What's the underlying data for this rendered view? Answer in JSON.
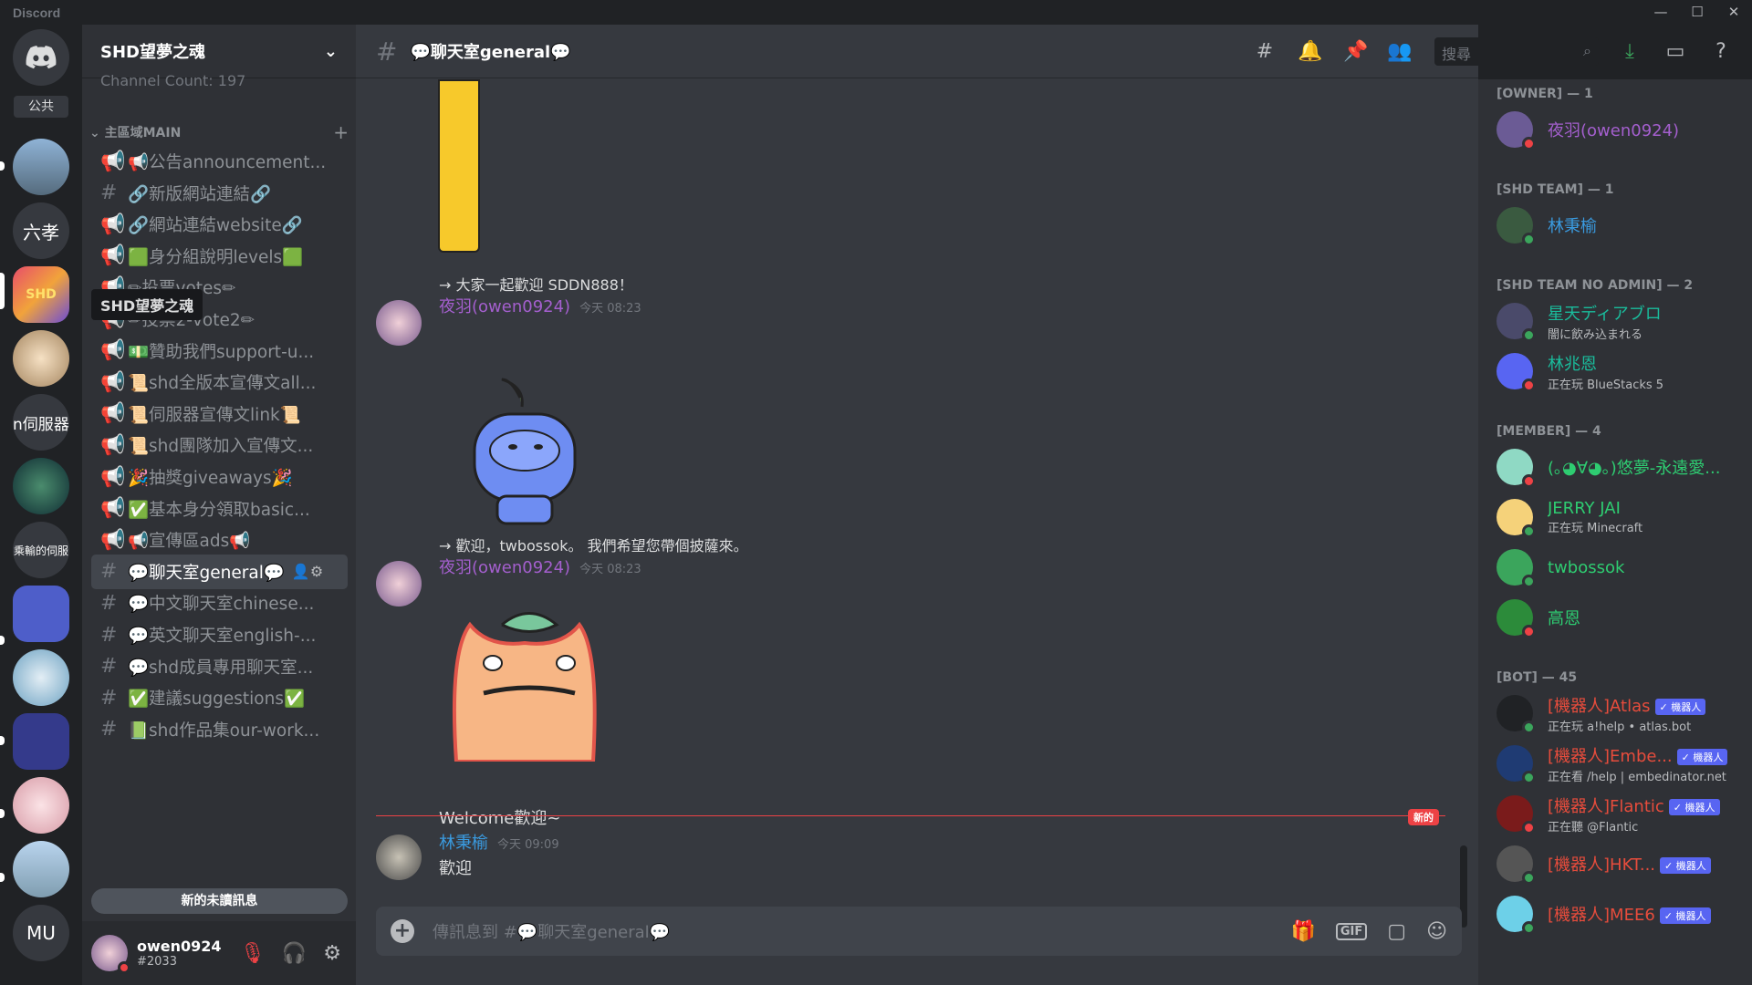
{
  "window": {
    "title": "Discord",
    "controls": [
      "—",
      "☐",
      "✕"
    ]
  },
  "servers": {
    "home_badge": "公共",
    "items": [
      "六孝",
      "n伺服器",
      "乘輸的伺服",
      "MU"
    ],
    "tooltip": "SHD望夢之魂"
  },
  "server": {
    "name": "SHD望夢之魂",
    "top_text": "Channel Count: 197",
    "category": "主區域MAIN",
    "unread_bar": "新的未讀訊息"
  },
  "channels": [
    {
      "sym": "📢",
      "name": "📢公告announcement..."
    },
    {
      "sym": "#",
      "name": "🔗新版網站連結🔗"
    },
    {
      "sym": "📢",
      "name": "🔗網站連結website🔗"
    },
    {
      "sym": "📢",
      "name": "🟩身分組說明levels🟩"
    },
    {
      "sym": "📢",
      "name": "✏投票votes✏"
    },
    {
      "sym": "📢",
      "name": "✏投票2-vote2✏"
    },
    {
      "sym": "📢",
      "name": "💵贊助我們support-u..."
    },
    {
      "sym": "📢",
      "name": "📜shd全版本宣傳文all..."
    },
    {
      "sym": "📢",
      "name": "📜伺服器宣傳文link📜"
    },
    {
      "sym": "📢",
      "name": "📜shd團隊加入宣傳文..."
    },
    {
      "sym": "📢",
      "name": "🎉抽獎giveaways🎉"
    },
    {
      "sym": "📢",
      "name": "✅基本身分領取basic..."
    },
    {
      "sym": "📢",
      "name": "📢宣傳區ads📢"
    },
    {
      "sym": "#",
      "name": "💬聊天室general💬"
    },
    {
      "sym": "#",
      "name": "💬中文聊天室chinese..."
    },
    {
      "sym": "#",
      "name": "💬英文聊天室english-..."
    },
    {
      "sym": "#",
      "name": "💬shd成員專用聊天室..."
    },
    {
      "sym": "#",
      "name": "✅建議suggestions✅"
    },
    {
      "sym": "#",
      "name": "📗shd作品集our-work..."
    }
  ],
  "user": {
    "name": "owen0924",
    "tag": "#2033"
  },
  "chat": {
    "channel_title": "💬聊天室general💬",
    "search_placeholder": "搜尋",
    "messages": [
      {
        "reply": "→ 大家一起歡迎 SDDN888！",
        "author": "夜羽(owen0924)",
        "time": "今天 08:23"
      },
      {
        "reply": "→ 歡迎，twbossok。 我們希望您帶個披薩來。",
        "author": "夜羽(owen0924)",
        "time": "今天 08:23",
        "text": "Welcome歡迎~"
      },
      {
        "author": "林秉榆",
        "time": "今天 09:09",
        "text": "歡迎"
      }
    ],
    "new_label": "新的",
    "composer_placeholder": "傳訊息到 #💬聊天室general💬",
    "gif_label": "GIF"
  },
  "members": {
    "groups": [
      {
        "title": "[OWNER] — 1",
        "items": [
          {
            "name": "夜羽(owen0924)",
            "color": "#a45fce",
            "status": "dnd"
          }
        ]
      },
      {
        "title": "[SHD TEAM] — 1",
        "items": [
          {
            "name": "林秉榆",
            "color": "#3a9be0",
            "status": "online"
          }
        ]
      },
      {
        "title": "[SHD TEAM NO ADMIN] — 2",
        "items": [
          {
            "name": "星天ディアブロ",
            "sub": "闇に飲み込まれる",
            "color": "#1abc9c",
            "status": "online"
          },
          {
            "name": "林兆恩",
            "sub": "正在玩 BlueStacks 5",
            "color": "#1abc9c",
            "status": "dnd"
          }
        ]
      },
      {
        "title": "[MEMBER] — 4",
        "items": [
          {
            "name": "(｡◕∀◕｡)悠夢-永遠愛...",
            "color": "#2ecc71",
            "status": "dnd"
          },
          {
            "name": "JERRY JAI",
            "sub": "正在玩 Minecraft",
            "color": "#2ecc71",
            "status": "online"
          },
          {
            "name": "twbossok",
            "color": "#2ecc71",
            "status": "online"
          },
          {
            "name": "高恩",
            "color": "#2ecc71",
            "status": "dnd"
          }
        ]
      },
      {
        "title": "[BOT] — 45",
        "items": [
          {
            "name": "[機器人]Atlas",
            "sub": "正在玩 a!help • atlas.bot",
            "color": "#e74c3c",
            "status": "online",
            "bot": "✓ 機器人"
          },
          {
            "name": "[機器人]Embe...",
            "sub": "正在看 /help | embedinator.net",
            "color": "#e74c3c",
            "status": "online",
            "bot": "✓ 機器人"
          },
          {
            "name": "[機器人]Flantic",
            "sub": "正在聽 @Flantic",
            "color": "#e74c3c",
            "status": "dnd",
            "bot": "✓ 機器人"
          },
          {
            "name": "[機器人]HKT...",
            "color": "#e74c3c",
            "status": "online",
            "bot": "✓ 機器人"
          },
          {
            "name": "[機器人]MEE6",
            "color": "#e74c3c",
            "status": "online",
            "bot": "✓ 機器人"
          }
        ]
      }
    ]
  }
}
